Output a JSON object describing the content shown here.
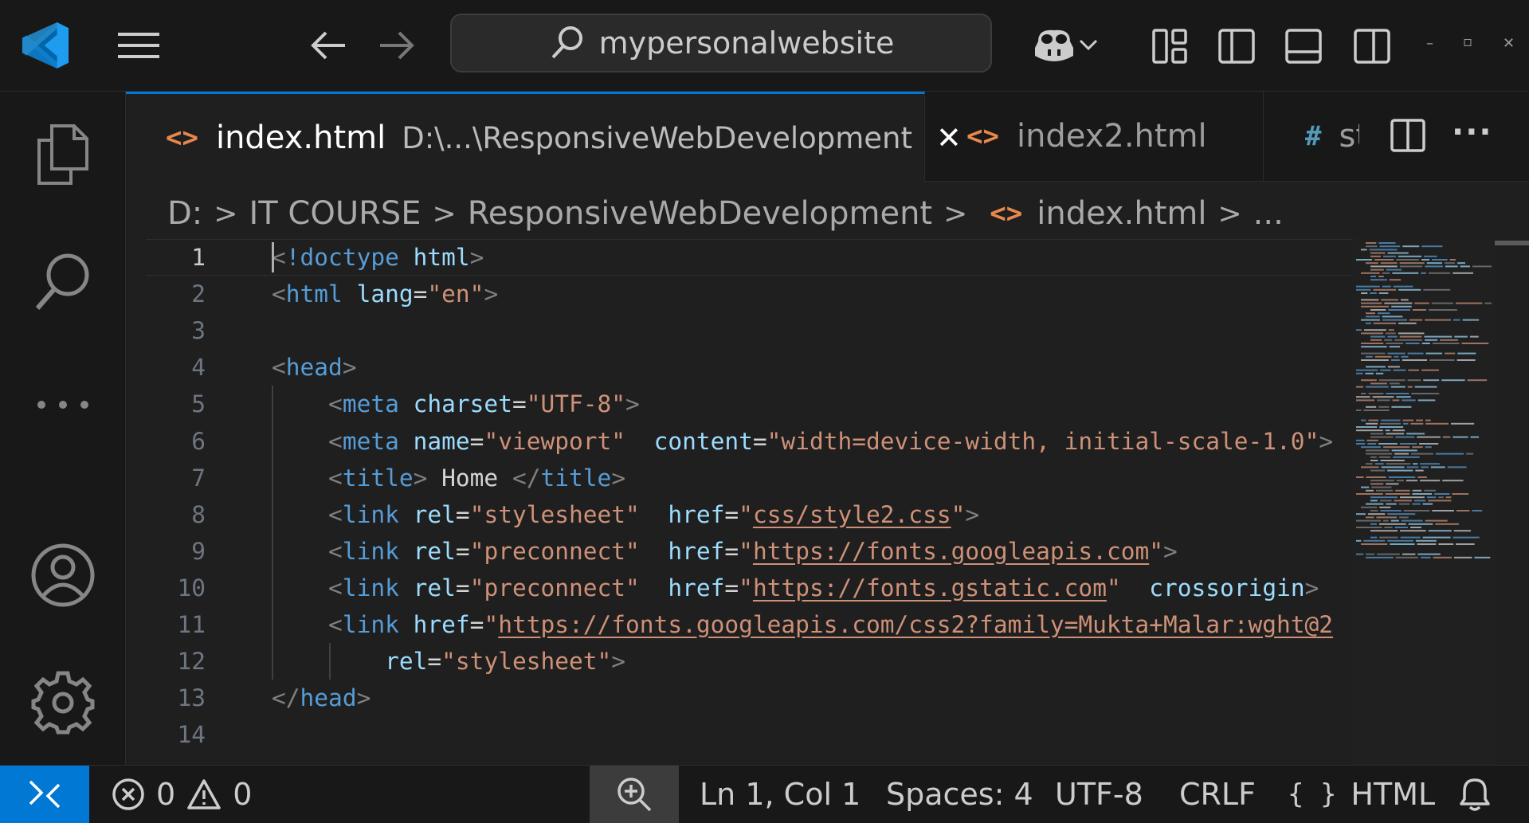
{
  "search": {
    "text": "mypersonalwebsite"
  },
  "window_controls": {
    "minimize": "–",
    "restore": "▫",
    "close": "✕"
  },
  "tabs": [
    {
      "icon": "<>",
      "name": "index.html",
      "path": "D:\\...\\ResponsiveWebDevelopment",
      "close": "✕"
    },
    {
      "icon": "<>",
      "name": "index2.html"
    },
    {
      "icon": "#",
      "name": "st"
    }
  ],
  "tab_actions": {
    "more": "···"
  },
  "breadcrumb": {
    "items": [
      "D:",
      "IT COURSE",
      "ResponsiveWebDevelopment",
      "index.html",
      "..."
    ],
    "sep": ">",
    "file_icon": "<>"
  },
  "editor": {
    "line_numbers": [
      "1",
      "2",
      "3",
      "4",
      "5",
      "6",
      "7",
      "8",
      "9",
      "10",
      "11",
      "12",
      "13",
      "14"
    ],
    "lines": [
      [
        [
          "br",
          "<"
        ],
        [
          "tag",
          "!doctype"
        ],
        [
          "txt",
          " "
        ],
        [
          "attr",
          "html"
        ],
        [
          "br",
          ">"
        ]
      ],
      [
        [
          "br",
          "<"
        ],
        [
          "tag",
          "html"
        ],
        [
          "txt",
          " "
        ],
        [
          "attr",
          "lang"
        ],
        [
          "txt",
          "="
        ],
        [
          "str",
          "\"en\""
        ],
        [
          "br",
          ">"
        ]
      ],
      [],
      [
        [
          "br",
          "<"
        ],
        [
          "tag",
          "head"
        ],
        [
          "br",
          ">"
        ]
      ],
      [
        [
          "txt",
          "    "
        ],
        [
          "br",
          "<"
        ],
        [
          "tag",
          "meta"
        ],
        [
          "txt",
          " "
        ],
        [
          "attr",
          "charset"
        ],
        [
          "txt",
          "="
        ],
        [
          "str",
          "\"UTF-8\""
        ],
        [
          "br",
          ">"
        ]
      ],
      [
        [
          "txt",
          "    "
        ],
        [
          "br",
          "<"
        ],
        [
          "tag",
          "meta"
        ],
        [
          "txt",
          " "
        ],
        [
          "attr",
          "name"
        ],
        [
          "txt",
          "="
        ],
        [
          "str",
          "\"viewport\""
        ],
        [
          "txt",
          "  "
        ],
        [
          "attr",
          "content"
        ],
        [
          "txt",
          "="
        ],
        [
          "str",
          "\"width=device-width, initial-scale-1.0\""
        ],
        [
          "br",
          ">"
        ]
      ],
      [
        [
          "txt",
          "    "
        ],
        [
          "br",
          "<"
        ],
        [
          "tag",
          "title"
        ],
        [
          "br",
          ">"
        ],
        [
          "txt",
          " Home "
        ],
        [
          "br",
          "</"
        ],
        [
          "tag",
          "title"
        ],
        [
          "br",
          ">"
        ]
      ],
      [
        [
          "txt",
          "    "
        ],
        [
          "br",
          "<"
        ],
        [
          "tag",
          "link"
        ],
        [
          "txt",
          " "
        ],
        [
          "attr",
          "rel"
        ],
        [
          "txt",
          "="
        ],
        [
          "str",
          "\"stylesheet\""
        ],
        [
          "txt",
          "  "
        ],
        [
          "attr",
          "href"
        ],
        [
          "txt",
          "="
        ],
        [
          "str",
          "\""
        ],
        [
          "link",
          "css/style2.css"
        ],
        [
          "str",
          "\""
        ],
        [
          "br",
          ">"
        ]
      ],
      [
        [
          "txt",
          "    "
        ],
        [
          "br",
          "<"
        ],
        [
          "tag",
          "link"
        ],
        [
          "txt",
          " "
        ],
        [
          "attr",
          "rel"
        ],
        [
          "txt",
          "="
        ],
        [
          "str",
          "\"preconnect\""
        ],
        [
          "txt",
          "  "
        ],
        [
          "attr",
          "href"
        ],
        [
          "txt",
          "="
        ],
        [
          "str",
          "\""
        ],
        [
          "link",
          "https://fonts.googleapis.com"
        ],
        [
          "str",
          "\""
        ],
        [
          "br",
          ">"
        ]
      ],
      [
        [
          "txt",
          "    "
        ],
        [
          "br",
          "<"
        ],
        [
          "tag",
          "link"
        ],
        [
          "txt",
          " "
        ],
        [
          "attr",
          "rel"
        ],
        [
          "txt",
          "="
        ],
        [
          "str",
          "\"preconnect\""
        ],
        [
          "txt",
          "  "
        ],
        [
          "attr",
          "href"
        ],
        [
          "txt",
          "="
        ],
        [
          "str",
          "\""
        ],
        [
          "link",
          "https://fonts.gstatic.com"
        ],
        [
          "str",
          "\""
        ],
        [
          "txt",
          "  "
        ],
        [
          "attr",
          "crossorigin"
        ],
        [
          "br",
          ">"
        ]
      ],
      [
        [
          "txt",
          "    "
        ],
        [
          "br",
          "<"
        ],
        [
          "tag",
          "link"
        ],
        [
          "txt",
          " "
        ],
        [
          "attr",
          "href"
        ],
        [
          "txt",
          "="
        ],
        [
          "str",
          "\""
        ],
        [
          "link",
          "https://fonts.googleapis.com/css2?family=Mukta+Malar:wght@2"
        ]
      ],
      [
        [
          "txt",
          "        "
        ],
        [
          "attr",
          "rel"
        ],
        [
          "txt",
          "="
        ],
        [
          "str",
          "\"stylesheet\""
        ],
        [
          "br",
          ">"
        ]
      ],
      [
        [
          "br",
          "</"
        ],
        [
          "tag",
          "head"
        ],
        [
          "br",
          ">"
        ]
      ],
      []
    ]
  },
  "status": {
    "errors": "0",
    "warnings": "0",
    "position": "Ln 1, Col 1",
    "spaces": "Spaces: 4",
    "encoding": "UTF-8",
    "eol": "CRLF",
    "language_icon": "{ }",
    "language": "HTML"
  }
}
